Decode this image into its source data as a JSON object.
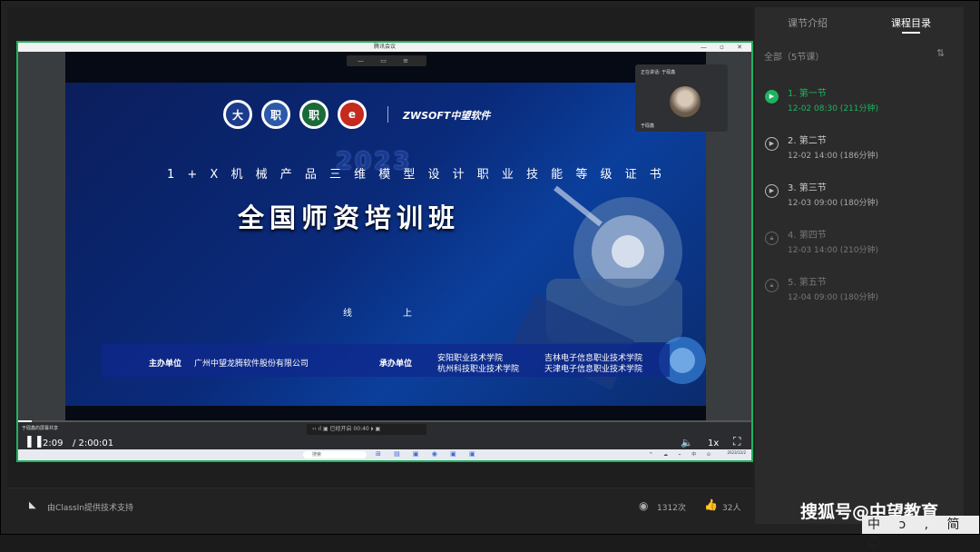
{
  "meeting": {
    "title": "腾讯会议",
    "window_buttons": "— ▫ ✕",
    "toolbar_glyphs": "— ▭ ≡"
  },
  "slide": {
    "logos": [
      "大",
      "职",
      "职",
      "e"
    ],
    "company": "ZWSOFT中望软件",
    "year": "2023",
    "subtitle": "1 + X 机 械 产 品 三 维 模 型 设 计 职 业 技 能 等 级 证 书",
    "title": "全国师资培训班",
    "mode_a": "线",
    "mode_b": "上",
    "host_label": "主办单位",
    "host_name": "广州中望龙腾软件股份有限公司",
    "organizer_label": "承办单位",
    "organizers": [
      "安阳职业技术学院",
      "吉林电子信息职业技术学院",
      "杭州科技职业技术学院",
      "天津电子信息职业技术学院"
    ]
  },
  "camera": {
    "speaking": "正在讲话: 于砚鑫",
    "name": "于砚鑫"
  },
  "player": {
    "share_label": "于砚鑫的屏幕共享",
    "mini_toolbar": "‹‹ ıl ▣ 已经开启 00:40 ⏵ ▣",
    "play_icon": "❚❚",
    "time_current": "2:09",
    "time_total": "/ 2:00:01",
    "progress_fraction": 0.018,
    "volume_icon": "🔈",
    "speed": "1x",
    "fullscreen_icon": "⛶",
    "taskbar_search": "搜索",
    "taskbar_icons": "⊞ ▤ ▣ ◉ ▣ ▣",
    "taskbar_tray": "^ ☁ ⌁ 中 ⊙",
    "taskbar_date": "2023/12/2"
  },
  "footer": {
    "provider": "由ClassIn提供技术支持",
    "views": "1312次",
    "likes": "32人"
  },
  "sidebar": {
    "tab_intro": "课节介绍",
    "tab_catalog": "课程目录",
    "filter": "全部（5节课）",
    "lessons": [
      {
        "title": "1. 第一节",
        "sub": "12-02 08:30 (211分钟)",
        "state": "active"
      },
      {
        "title": "2. 第二节",
        "sub": "12-02 14:00 (186分钟)",
        "state": "normal"
      },
      {
        "title": "3. 第三节",
        "sub": "12-03 09:00 (180分钟)",
        "state": "normal"
      },
      {
        "title": "4. 第四节",
        "sub": "12-03 14:00 (210分钟)",
        "state": "locked"
      },
      {
        "title": "5. 第五节",
        "sub": "12-04 09:00 (180分钟)",
        "state": "locked"
      }
    ]
  },
  "watermark": "搜狐号@中望教育",
  "ime": "中 ɔ , 简 ☺",
  "colors": {
    "accent": "#1fb361",
    "slide_blue": "#0a2a7a"
  }
}
